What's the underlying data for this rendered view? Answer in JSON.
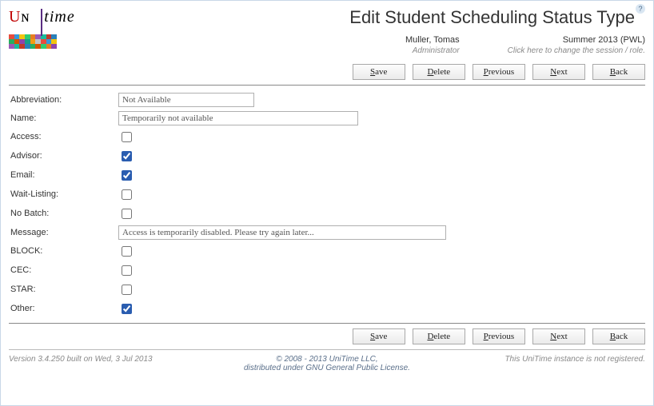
{
  "header": {
    "logo_text_uni": "Uɴɪ",
    "logo_text_time": "time",
    "title": "Edit Student Scheduling Status Type",
    "help_symbol": "?",
    "user_name": "Muller, Tomas",
    "user_role": "Administrator",
    "session_name": "Summer 2013 (PWL)",
    "session_hint": "Click here to change the session / role."
  },
  "buttons": {
    "save": "Save",
    "delete": "Delete",
    "previous": "Previous",
    "next": "Next",
    "back": "Back"
  },
  "form": {
    "labels": {
      "abbreviation": "Abbreviation:",
      "name": "Name:",
      "access": "Access:",
      "advisor": "Advisor:",
      "email": "Email:",
      "waitlisting": "Wait-Listing:",
      "nobatch": "No Batch:",
      "message": "Message:",
      "block": "BLOCK:",
      "cec": "CEC:",
      "star": "STAR:",
      "other": "Other:"
    },
    "values": {
      "abbreviation": "Not Available",
      "name": "Temporarily not available",
      "access": false,
      "advisor": true,
      "email": true,
      "waitlisting": false,
      "nobatch": false,
      "message": "Access is temporarily disabled. Please try again later...",
      "block": false,
      "cec": false,
      "star": false,
      "other": true
    }
  },
  "footer": {
    "version": "Version 3.4.250 built on Wed, 3 Jul 2013",
    "copyright_line1": "© 2008 - 2013 UniTime LLC,",
    "copyright_line2": "distributed under GNU General Public License.",
    "registration": "This UniTime instance is not registered."
  }
}
